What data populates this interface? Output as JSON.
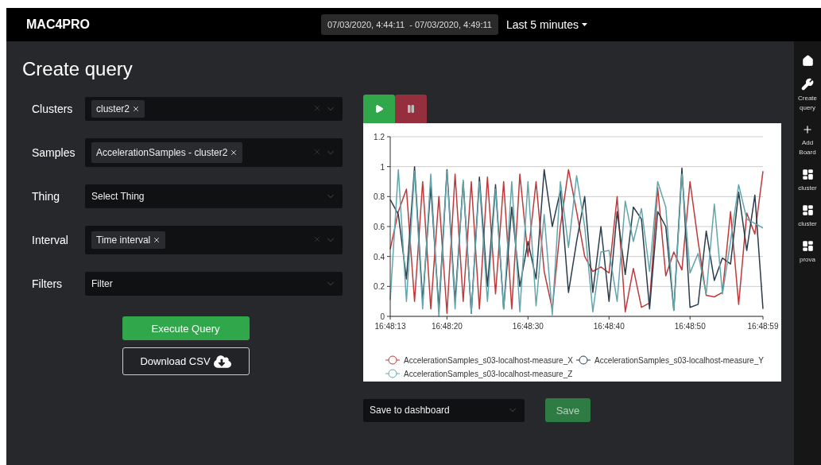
{
  "header": {
    "brand": "MAC4PRO",
    "time_range": "07/03/2020, 4:44:11  - 07/03/2020, 4:49:11",
    "range_menu": "Last 5 minutes"
  },
  "page_title": "Create query",
  "form": [
    {
      "label": "Clusters",
      "kind": "multi",
      "chips": [
        "cluster2"
      ]
    },
    {
      "label": "Samples",
      "kind": "multi",
      "chips": [
        "AccelerationSamples - cluster2"
      ]
    },
    {
      "label": "Thing",
      "kind": "single",
      "placeholder": "Select Thing"
    },
    {
      "label": "Interval",
      "kind": "multi",
      "chips": [
        "Time interval"
      ]
    },
    {
      "label": "Filters",
      "kind": "single",
      "placeholder": "Filter"
    }
  ],
  "actions": {
    "execute": "Execute Query",
    "download": "Download CSV"
  },
  "player": [
    {
      "kind": "play",
      "selected": true
    },
    {
      "kind": "pause",
      "selected": false
    }
  ],
  "chart": {
    "chart_data": {
      "type": "line",
      "categories": [
        "16:48:13",
        null,
        null,
        null,
        null,
        null,
        null,
        "16:48:20",
        null,
        null,
        null,
        null,
        null,
        null,
        null,
        null,
        null,
        "16:48:30",
        null,
        null,
        null,
        null,
        null,
        null,
        null,
        null,
        null,
        "16:48:40",
        null,
        null,
        null,
        null,
        null,
        null,
        null,
        null,
        null,
        "16:48:50",
        null,
        null,
        null,
        null,
        null,
        null,
        null,
        null,
        "16:48:59"
      ],
      "ylim": [
        0,
        1.2
      ],
      "grid": true,
      "legend": true,
      "yticks": [
        0,
        0.2,
        0.4,
        0.6,
        0.8,
        1,
        1.2
      ],
      "series": [
        {
          "name": "AccelerationSamples_s03-localhost-measure_X",
          "color": "#c0393b",
          "values": [
            0.45,
            0.7,
            0.85,
            0.1,
            0.9,
            0.05,
            0.8,
            0.02,
            0.95,
            0.1,
            0.9,
            0.05,
            0.93,
            0.15,
            0.9,
            0.05,
            0.95,
            0.4,
            0.9,
            0.3,
            0.05,
            0.6,
            0.98,
            0.7,
            0.4,
            0.3,
            0.33,
            0.29,
            0.8,
            0.03,
            0.32,
            0.06,
            0.09,
            0.86,
            0.27,
            0.43,
            0.31,
            0.9,
            0.5,
            0.14,
            0.13,
            0.16,
            0.7,
            0.08,
            0.69,
            0.55,
            0.97
          ]
        },
        {
          "name": "AccelerationSamples_s03-localhost-measure_Y",
          "color": "#2b3d4c",
          "values": [
            0.78,
            0.68,
            0.25,
            1.0,
            0.1,
            0.87,
            0.05,
            0.98,
            0.1,
            0.9,
            0.02,
            0.93,
            0.2,
            0.88,
            0.05,
            0.73,
            0.2,
            0.5,
            0.25,
            0.98,
            0.6,
            0.84,
            0.16,
            0.5,
            0.8,
            0.16,
            0.6,
            0.1,
            0.7,
            0.28,
            0.73,
            0.65,
            0.05,
            0.7,
            0.6,
            0.04,
            0.99,
            0.06,
            0.08,
            0.57,
            0.24,
            0.39,
            0.35,
            0.83,
            0.44,
            0.81,
            0.05
          ]
        },
        {
          "name": "AccelerationSamples_s03-localhost-measure_Z",
          "color": "#62a6ac",
          "values": [
            0.11,
            0.98,
            0.1,
            0.97,
            0.05,
            0.95,
            0.0,
            0.97,
            0.05,
            0.91,
            0.02,
            0.9,
            0.1,
            0.85,
            0.05,
            0.9,
            0.03,
            0.9,
            0.07,
            0.68,
            0.01,
            0.9,
            0.46,
            0.94,
            0.6,
            0.03,
            0.43,
            0.44,
            0.1,
            0.77,
            0.5,
            0.72,
            0.3,
            0.9,
            0.73,
            0.04,
            0.95,
            0.29,
            0.42,
            0.15,
            0.75,
            0.15,
            0.5,
            0.88,
            0.65,
            0.62,
            0.59
          ]
        }
      ]
    }
  },
  "save": {
    "placeholder": "Save to dashboard",
    "button": "Save"
  },
  "sidebar": [
    {
      "kind": "home"
    },
    {
      "kind": "tool",
      "label": "Create query"
    },
    {
      "kind": "add",
      "label": "Add Board"
    },
    {
      "kind": "board",
      "label": "cluster"
    },
    {
      "kind": "board",
      "label": "cluster"
    },
    {
      "kind": "board",
      "label": "prova"
    }
  ]
}
